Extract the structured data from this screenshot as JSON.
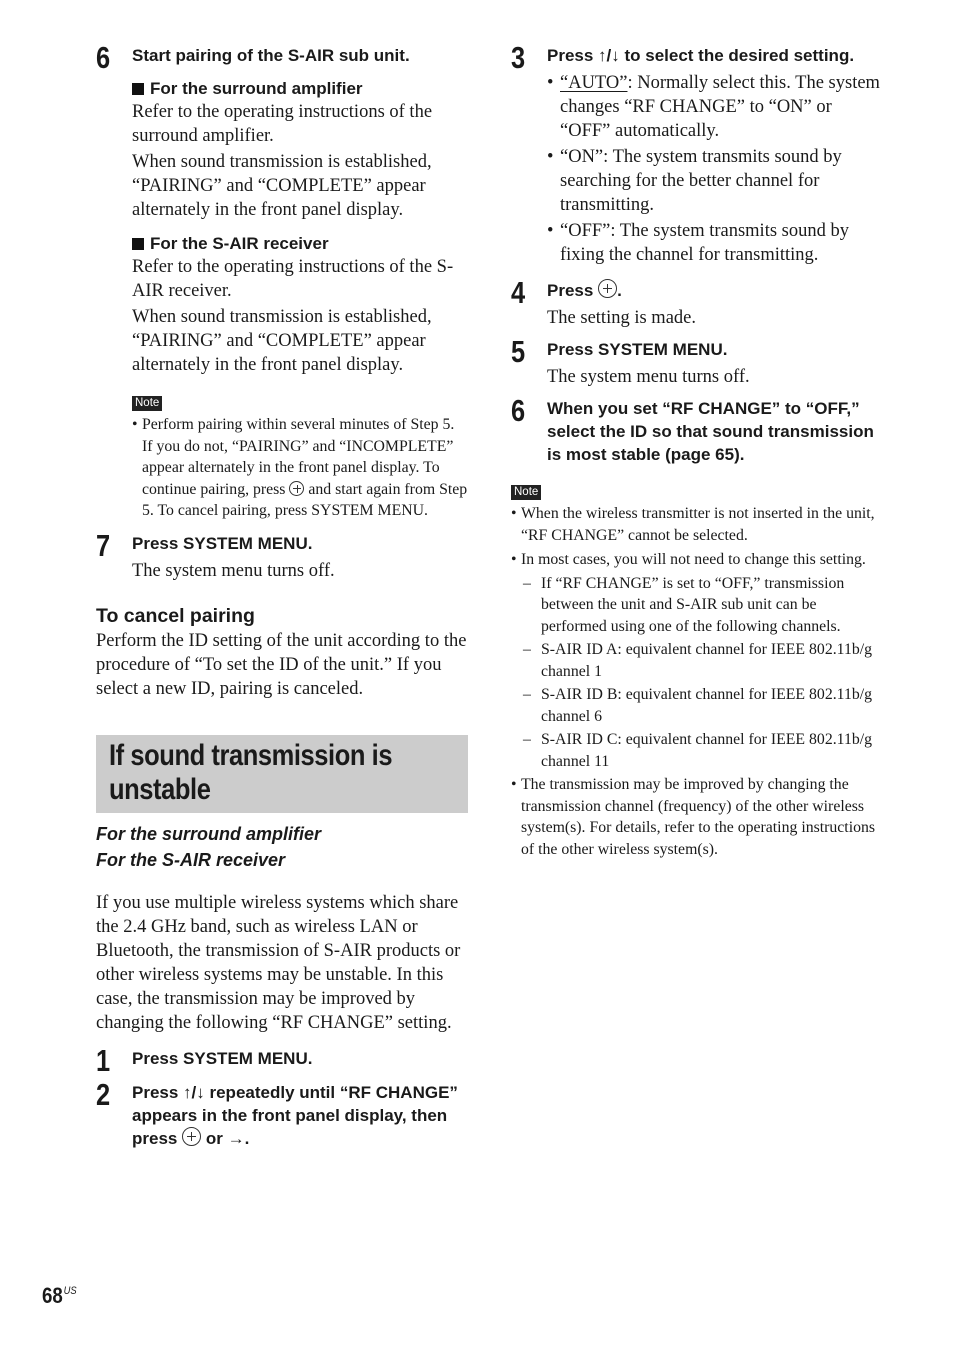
{
  "left": {
    "step6": {
      "num": "6",
      "title": "Start pairing of the S-AIR sub unit.",
      "sub1": {
        "heading": "For the surround amplifier",
        "para1": "Refer to the operating instructions of the surround amplifier.",
        "para2": "When sound transmission is established, “PAIRING” and “COMPLETE” appear alternately in the front panel display."
      },
      "sub2": {
        "heading": "For the S-AIR receiver",
        "para1": "Refer to the operating instructions of the S-AIR receiver.",
        "para2": "When sound transmission is established, “PAIRING” and “COMPLETE” appear alternately in the front panel display."
      },
      "note": {
        "badge": "Note",
        "text_before": "Perform pairing within several minutes of Step 5. If you do not, “PAIRING” and “INCOMPLETE” appear alternately in the front panel display. To continue pairing, press",
        "button_icon": "enter-button-icon",
        "text_after": "and start again from Step 5. To cancel pairing, press SYSTEM MENU."
      }
    },
    "step7": {
      "num": "7",
      "title": "Press SYSTEM MENU.",
      "body": "The system menu turns off."
    },
    "cancel": {
      "heading": "To cancel pairing",
      "body": "Perform the ID setting of the unit according to the procedure of “To set the ID of the unit.” If you select a new ID, pairing is canceled."
    },
    "section": {
      "title_line1": "If sound transmission is",
      "title_line2": "unstable",
      "applies_to": [
        "For the surround amplifier",
        "For the S-AIR receiver"
      ],
      "intro": "If you use multiple wireless systems which share the 2.4 GHz band, such as wireless LAN or Bluetooth, the transmission of S-AIR products or other wireless systems may be unstable. In this case, the transmission may be improved by changing the following “RF CHANGE” setting."
    },
    "step1": {
      "num": "1",
      "title": "Press SYSTEM MENU."
    },
    "step2": {
      "num": "2",
      "title_before": "Press ↑/↓ repeatedly until “RF CHANGE” appears in the front panel display, then press",
      "title_after": "or →."
    }
  },
  "right": {
    "step3": {
      "num": "3",
      "title": "Press ↑/↓ to select the desired setting.",
      "options": [
        {
          "label": "“AUTO”",
          "text": ": Normally select this. The system changes “RF CHANGE” to “ON” or “OFF” automatically.",
          "default": true
        },
        {
          "label": "“ON”",
          "text": ": The system transmits sound by searching for the better channel for transmitting.",
          "default": false
        },
        {
          "label": "“OFF”",
          "text": ": The system transmits sound by fixing the channel for transmitting.",
          "default": false
        }
      ]
    },
    "step4": {
      "num": "4",
      "title": "Press",
      "title_after": ".",
      "body": "The setting is made."
    },
    "step5": {
      "num": "5",
      "title": "Press SYSTEM MENU.",
      "body": "The system menu turns off."
    },
    "step6": {
      "num": "6",
      "title": "When you set “RF CHANGE” to “OFF,” select the ID so that sound transmission is most stable (page 65)."
    },
    "note": {
      "badge": "Note",
      "items": [
        {
          "text": "When the wireless transmitter is not inserted in the unit, “RF CHANGE” cannot be selected."
        },
        {
          "text": "In most cases, you will not need to change this setting."
        }
      ],
      "sub_items": [
        "If “RF CHANGE” is set to “OFF,” transmission between the unit and S-AIR sub unit can be performed using one of the following channels.",
        "S-AIR ID A: equivalent channel for IEEE 802.11b/g channel 1",
        "S-AIR ID B: equivalent channel for IEEE 802.11b/g channel 6",
        "S-AIR ID C: equivalent channel for IEEE 802.11b/g channel 11"
      ],
      "last_item": "The transmission may be improved by changing the transmission channel (frequency) of the other wireless system(s). For details, refer to the operating instructions of the other wireless system(s)."
    }
  },
  "footer": {
    "page_number": "68",
    "region": "US"
  }
}
